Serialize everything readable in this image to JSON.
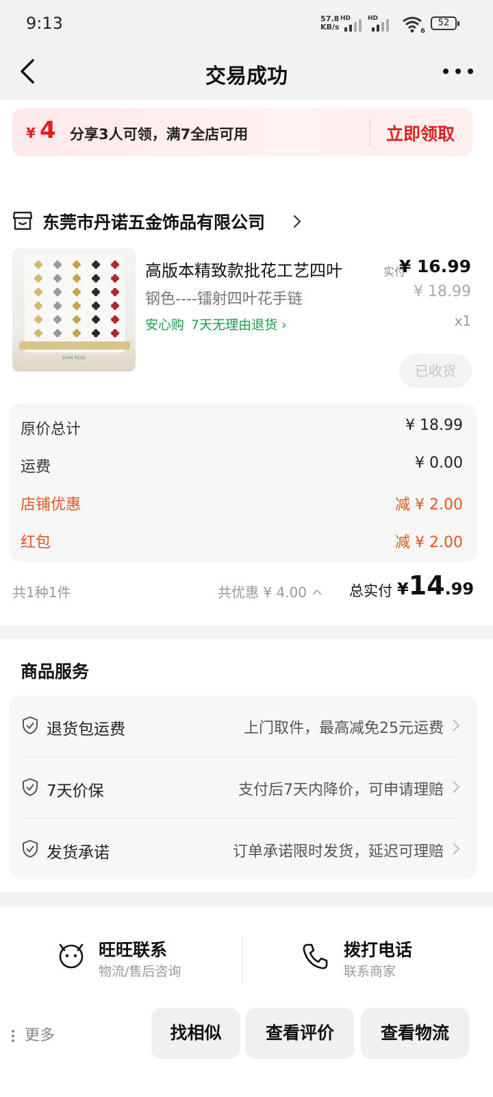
{
  "status_bar": {
    "time": "9:13",
    "net_speed_value": "57.8",
    "net_speed_unit": "KB/s",
    "signal_label": "HD",
    "battery": "52"
  },
  "header": {
    "title": "交易成功",
    "back_icon": "chevron-left-icon",
    "more_icon": "more-dots-icon"
  },
  "coupon": {
    "currency": "¥",
    "amount": "4",
    "description": "分享3人可领，满7全店可用",
    "claim_label": "立即领取"
  },
  "store": {
    "name": "东莞市丹诺五金饰品有限公司",
    "icon": "store-icon"
  },
  "product": {
    "title": "高版本精致款批花工艺四叶",
    "variant": "钢色----镭射四叶花手链",
    "guarantee_1": "安心购",
    "guarantee_2": "7天无理由退货 ›",
    "paid_label": "实付",
    "paid_price": "¥ 16.99",
    "original_price": "¥ 18.99",
    "quantity": "x1",
    "status_button": "已收货",
    "image_brand_text": "DAN NUO"
  },
  "breakdown": {
    "rows": [
      {
        "label": "原价总计",
        "value": "¥ 18.99"
      },
      {
        "label": "运费",
        "value": "¥ 0.00"
      },
      {
        "label": "店铺优惠",
        "value": "减 ¥ 2.00"
      },
      {
        "label": "红包",
        "value": "减 ¥ 2.00"
      }
    ]
  },
  "summary": {
    "count": "共1种1件",
    "discount": "共优惠 ¥ 4.00",
    "total_label": "总实付",
    "total_currency": "¥",
    "total_int": "14",
    "total_dec": ".99"
  },
  "services": {
    "title": "商品服务",
    "items": [
      {
        "name": "退货包运费",
        "desc": "上门取件，最高减免25元运费"
      },
      {
        "name": "7天价保",
        "desc": "支付后7天内降价，可申请理赔"
      },
      {
        "name": "发货承诺",
        "desc": "订单承诺限时发货，延迟可理赔"
      }
    ]
  },
  "contact": {
    "wangwang_label": "旺旺联系",
    "wangwang_sub": "物流/售后咨询",
    "phone_label": "拨打电话",
    "phone_sub": "联系商家"
  },
  "actions": {
    "more": "更多",
    "similar": "找相似",
    "reviews": "查看评价",
    "logistics": "查看物流"
  },
  "colors": {
    "accent_red": "#e02020",
    "discount_orange": "#e8541e",
    "guarantee_green": "#1a9e4a"
  }
}
